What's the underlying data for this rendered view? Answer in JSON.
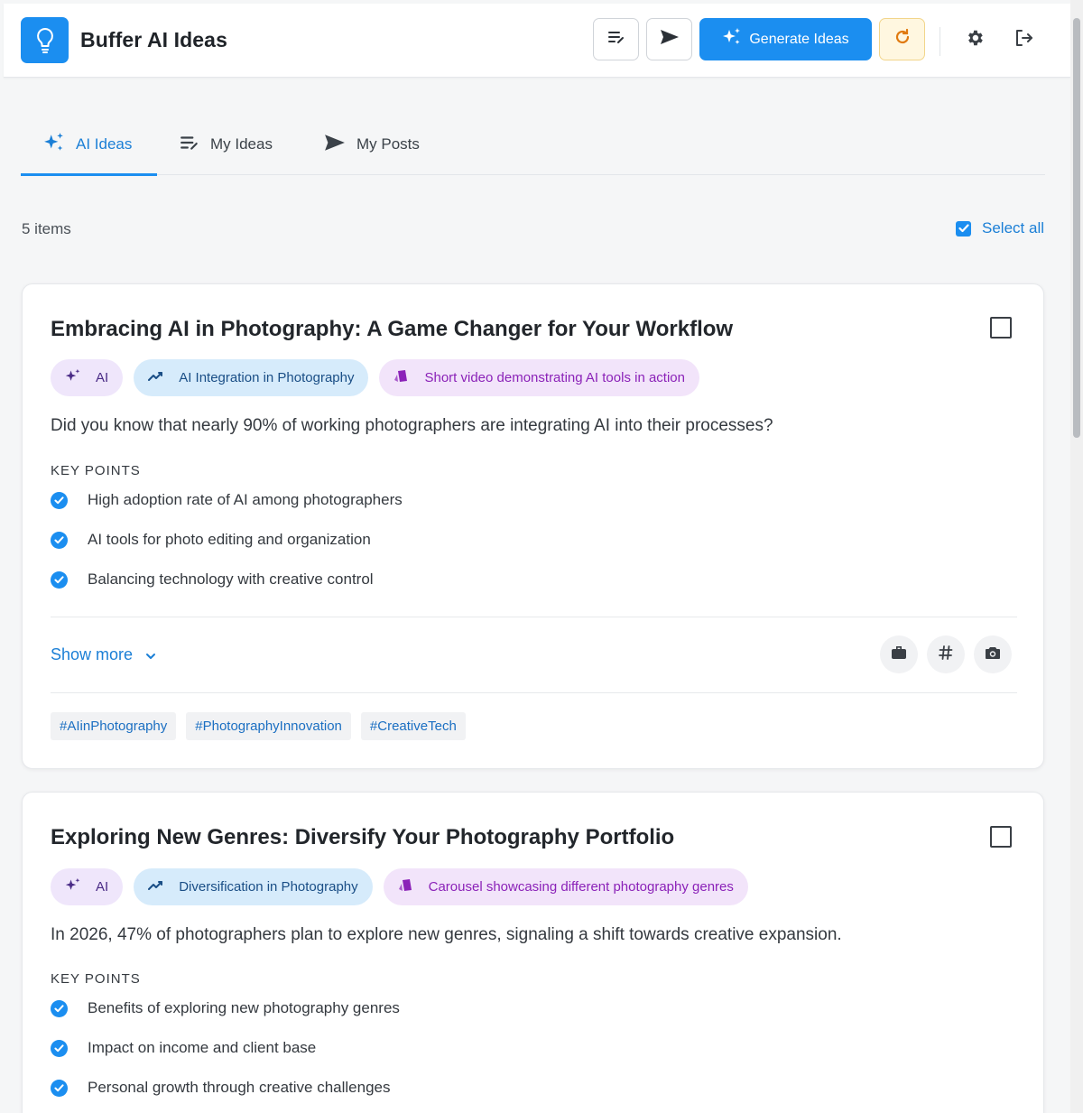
{
  "header": {
    "brand": "Buffer AI Ideas",
    "generate_label": "Generate Ideas",
    "accent_color": "#1b8ef0"
  },
  "tabs": [
    {
      "label": "AI Ideas",
      "icon": "sparkle-icon",
      "active": true
    },
    {
      "label": "My Ideas",
      "icon": "edit-list-icon",
      "active": false
    },
    {
      "label": "My Posts",
      "icon": "send-icon",
      "active": false
    }
  ],
  "toolbar": {
    "items_count": "5 items",
    "select_all": "Select all"
  },
  "cards": [
    {
      "title": "Embracing AI in Photography: A Game Changer for Your Workflow",
      "chips": {
        "ai": "AI",
        "trend": "AI Integration in Photography",
        "format": "Short video demonstrating AI tools in action"
      },
      "hook": "Did you know that nearly 90% of working photographers are integrating AI into their processes?",
      "key_points_label": "KEY POINTS",
      "key_points": [
        "High adoption rate of AI among photographers",
        "AI tools for photo editing and organization",
        "Balancing technology with creative control"
      ],
      "show_more": "Show more",
      "hashtags": [
        "#AIinPhotography",
        "#PhotographyInnovation",
        "#CreativeTech"
      ]
    },
    {
      "title": "Exploring New Genres: Diversify Your Photography Portfolio",
      "chips": {
        "ai": "AI",
        "trend": "Diversification in Photography",
        "format": "Carousel showcasing different photography genres"
      },
      "hook": "In 2026, 47% of photographers plan to explore new genres, signaling a shift towards creative expansion.",
      "key_points_label": "KEY POINTS",
      "key_points": [
        "Benefits of exploring new photography genres",
        "Impact on income and client base",
        "Personal growth through creative challenges"
      ]
    }
  ]
}
